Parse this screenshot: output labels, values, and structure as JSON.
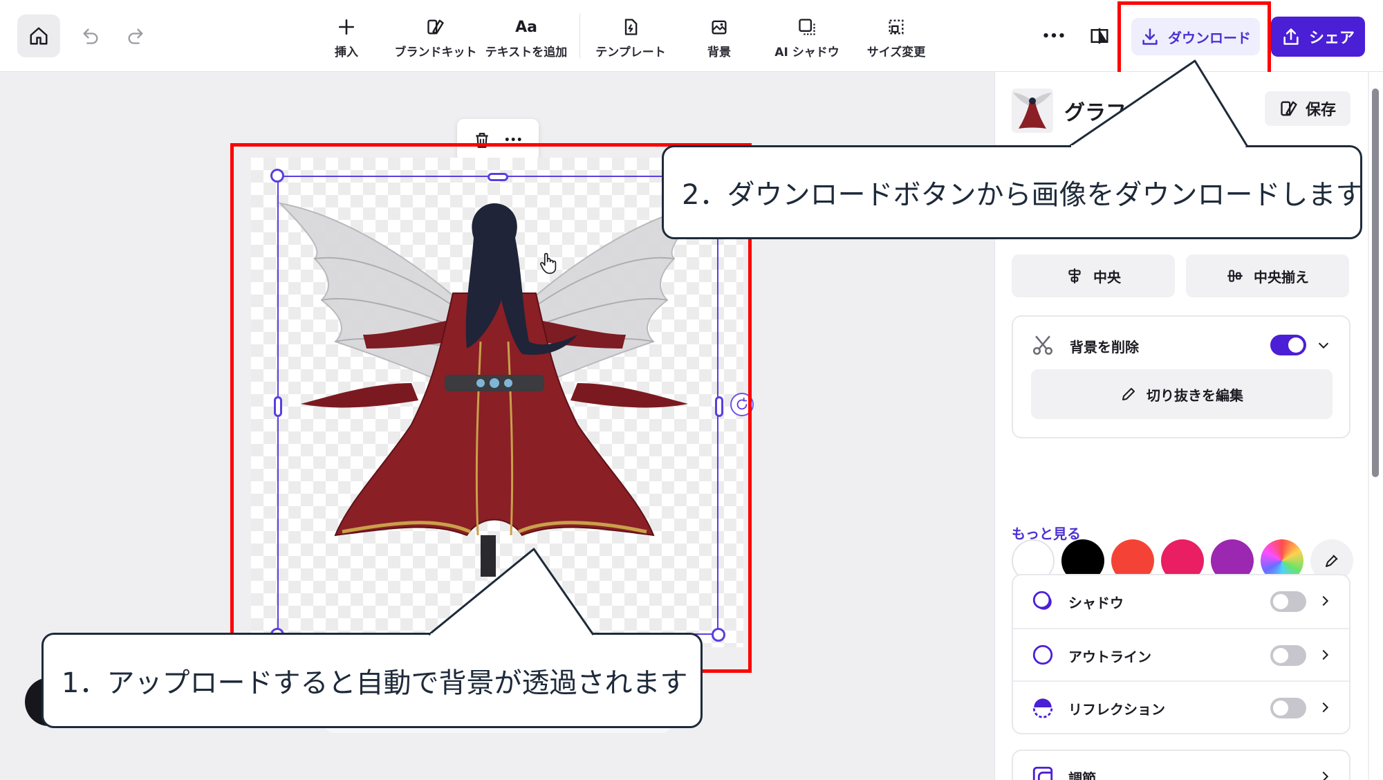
{
  "toolbar": {
    "tools": [
      {
        "label": "挿入",
        "icon": "plus-icon"
      },
      {
        "label": "ブランドキット",
        "icon": "brand-kit-icon"
      },
      {
        "label": "テキストを追加",
        "icon": "text-aa-icon"
      },
      {
        "label": "テンプレート",
        "icon": "template-icon"
      },
      {
        "label": "背景",
        "icon": "background-icon"
      },
      {
        "label": "AI シャドウ",
        "icon": "ai-shadow-icon"
      },
      {
        "label": "サイズ変更",
        "icon": "resize-icon"
      }
    ],
    "aa_glyph": "Aa",
    "more_glyph": "•••",
    "download_label": "ダウンロード",
    "share_label": "シェア"
  },
  "panel": {
    "title": "グラフィ",
    "save_label": "保存",
    "align_center": "中央",
    "align_middle": "中央揃え",
    "remove_bg_label": "背景を削除",
    "remove_bg_enabled": true,
    "edit_cutout_label": "切り抜きを編集",
    "colors": [
      "#ffffff",
      "#000000",
      "#f44336",
      "#e91e63",
      "#9c27b0"
    ],
    "more_link": "もっと見る",
    "effects": [
      {
        "label": "シャドウ",
        "enabled": false
      },
      {
        "label": "アウトライン",
        "enabled": false
      },
      {
        "label": "リフレクション",
        "enabled": false
      },
      {
        "label": "調節"
      }
    ]
  },
  "callouts": {
    "step1": "1．アップロードすると自動で背景が透過されます",
    "step2": "2．ダウンロードボタンから画像をダウンロードします"
  }
}
